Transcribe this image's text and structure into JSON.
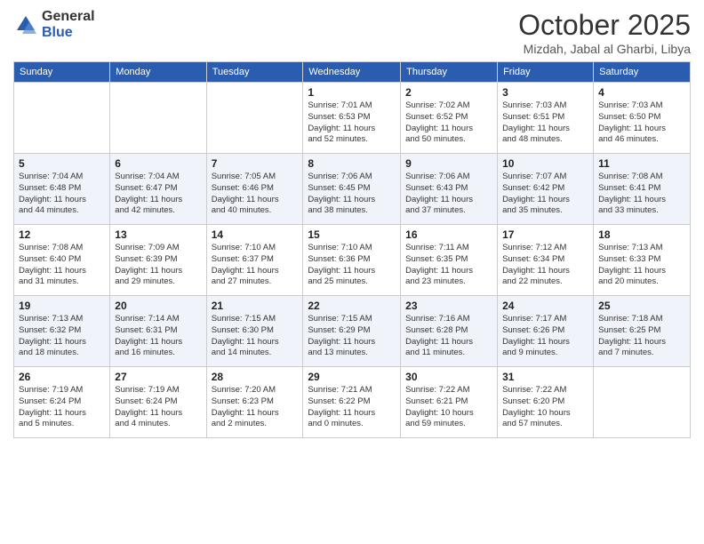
{
  "logo": {
    "general": "General",
    "blue": "Blue"
  },
  "header": {
    "month": "October 2025",
    "location": "Mizdah, Jabal al Gharbi, Libya"
  },
  "weekdays": [
    "Sunday",
    "Monday",
    "Tuesday",
    "Wednesday",
    "Thursday",
    "Friday",
    "Saturday"
  ],
  "weeks": [
    [
      {
        "day": "",
        "info": ""
      },
      {
        "day": "",
        "info": ""
      },
      {
        "day": "",
        "info": ""
      },
      {
        "day": "1",
        "info": "Sunrise: 7:01 AM\nSunset: 6:53 PM\nDaylight: 11 hours\nand 52 minutes."
      },
      {
        "day": "2",
        "info": "Sunrise: 7:02 AM\nSunset: 6:52 PM\nDaylight: 11 hours\nand 50 minutes."
      },
      {
        "day": "3",
        "info": "Sunrise: 7:03 AM\nSunset: 6:51 PM\nDaylight: 11 hours\nand 48 minutes."
      },
      {
        "day": "4",
        "info": "Sunrise: 7:03 AM\nSunset: 6:50 PM\nDaylight: 11 hours\nand 46 minutes."
      }
    ],
    [
      {
        "day": "5",
        "info": "Sunrise: 7:04 AM\nSunset: 6:48 PM\nDaylight: 11 hours\nand 44 minutes."
      },
      {
        "day": "6",
        "info": "Sunrise: 7:04 AM\nSunset: 6:47 PM\nDaylight: 11 hours\nand 42 minutes."
      },
      {
        "day": "7",
        "info": "Sunrise: 7:05 AM\nSunset: 6:46 PM\nDaylight: 11 hours\nand 40 minutes."
      },
      {
        "day": "8",
        "info": "Sunrise: 7:06 AM\nSunset: 6:45 PM\nDaylight: 11 hours\nand 38 minutes."
      },
      {
        "day": "9",
        "info": "Sunrise: 7:06 AM\nSunset: 6:43 PM\nDaylight: 11 hours\nand 37 minutes."
      },
      {
        "day": "10",
        "info": "Sunrise: 7:07 AM\nSunset: 6:42 PM\nDaylight: 11 hours\nand 35 minutes."
      },
      {
        "day": "11",
        "info": "Sunrise: 7:08 AM\nSunset: 6:41 PM\nDaylight: 11 hours\nand 33 minutes."
      }
    ],
    [
      {
        "day": "12",
        "info": "Sunrise: 7:08 AM\nSunset: 6:40 PM\nDaylight: 11 hours\nand 31 minutes."
      },
      {
        "day": "13",
        "info": "Sunrise: 7:09 AM\nSunset: 6:39 PM\nDaylight: 11 hours\nand 29 minutes."
      },
      {
        "day": "14",
        "info": "Sunrise: 7:10 AM\nSunset: 6:37 PM\nDaylight: 11 hours\nand 27 minutes."
      },
      {
        "day": "15",
        "info": "Sunrise: 7:10 AM\nSunset: 6:36 PM\nDaylight: 11 hours\nand 25 minutes."
      },
      {
        "day": "16",
        "info": "Sunrise: 7:11 AM\nSunset: 6:35 PM\nDaylight: 11 hours\nand 23 minutes."
      },
      {
        "day": "17",
        "info": "Sunrise: 7:12 AM\nSunset: 6:34 PM\nDaylight: 11 hours\nand 22 minutes."
      },
      {
        "day": "18",
        "info": "Sunrise: 7:13 AM\nSunset: 6:33 PM\nDaylight: 11 hours\nand 20 minutes."
      }
    ],
    [
      {
        "day": "19",
        "info": "Sunrise: 7:13 AM\nSunset: 6:32 PM\nDaylight: 11 hours\nand 18 minutes."
      },
      {
        "day": "20",
        "info": "Sunrise: 7:14 AM\nSunset: 6:31 PM\nDaylight: 11 hours\nand 16 minutes."
      },
      {
        "day": "21",
        "info": "Sunrise: 7:15 AM\nSunset: 6:30 PM\nDaylight: 11 hours\nand 14 minutes."
      },
      {
        "day": "22",
        "info": "Sunrise: 7:15 AM\nSunset: 6:29 PM\nDaylight: 11 hours\nand 13 minutes."
      },
      {
        "day": "23",
        "info": "Sunrise: 7:16 AM\nSunset: 6:28 PM\nDaylight: 11 hours\nand 11 minutes."
      },
      {
        "day": "24",
        "info": "Sunrise: 7:17 AM\nSunset: 6:26 PM\nDaylight: 11 hours\nand 9 minutes."
      },
      {
        "day": "25",
        "info": "Sunrise: 7:18 AM\nSunset: 6:25 PM\nDaylight: 11 hours\nand 7 minutes."
      }
    ],
    [
      {
        "day": "26",
        "info": "Sunrise: 7:19 AM\nSunset: 6:24 PM\nDaylight: 11 hours\nand 5 minutes."
      },
      {
        "day": "27",
        "info": "Sunrise: 7:19 AM\nSunset: 6:24 PM\nDaylight: 11 hours\nand 4 minutes."
      },
      {
        "day": "28",
        "info": "Sunrise: 7:20 AM\nSunset: 6:23 PM\nDaylight: 11 hours\nand 2 minutes."
      },
      {
        "day": "29",
        "info": "Sunrise: 7:21 AM\nSunset: 6:22 PM\nDaylight: 11 hours\nand 0 minutes."
      },
      {
        "day": "30",
        "info": "Sunrise: 7:22 AM\nSunset: 6:21 PM\nDaylight: 10 hours\nand 59 minutes."
      },
      {
        "day": "31",
        "info": "Sunrise: 7:22 AM\nSunset: 6:20 PM\nDaylight: 10 hours\nand 57 minutes."
      },
      {
        "day": "",
        "info": ""
      }
    ]
  ]
}
